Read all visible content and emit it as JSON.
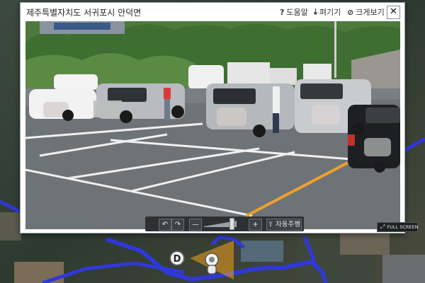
{
  "popup": {
    "title": "제주특별자치도 서귀포시 안덕면",
    "help_label": "도움말",
    "expand_label": "펴기기",
    "enlarge_label": "크게보기",
    "close_label": "✕"
  },
  "icons": {
    "help": "?",
    "download": "⤓",
    "link": "⊘"
  },
  "controls": {
    "rotate_left": "↶",
    "rotate_right": "↷",
    "zoom_out": "—",
    "zoom_in": "+",
    "auto_label": "⇧ 자동주행",
    "fullscreen_label": "FULL SCREEN",
    "zoom_level": 0.9
  },
  "map": {
    "marker_label": "D"
  },
  "colors": {
    "route": "#2f38d8",
    "accent": "#f2a31b"
  }
}
